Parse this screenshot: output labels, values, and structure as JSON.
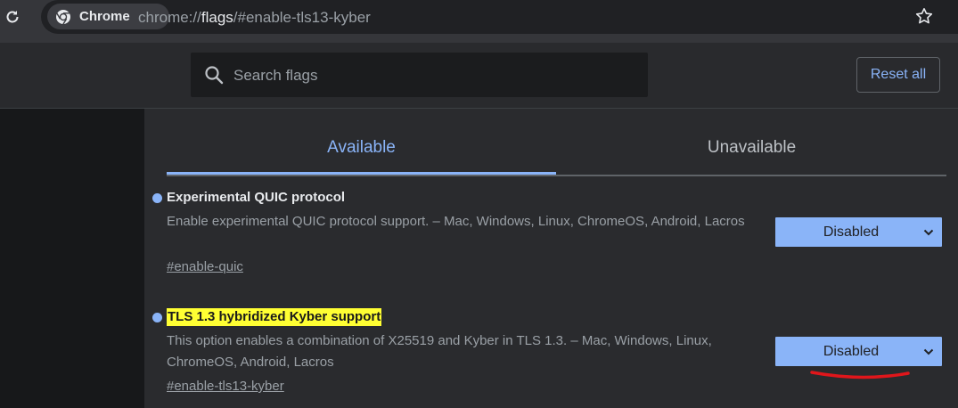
{
  "browser": {
    "chip_label": "Chrome",
    "url_scheme": "chrome://",
    "url_host": "flags",
    "url_path": "/#enable-tls13-kyber"
  },
  "header": {
    "search_placeholder": "Search flags",
    "reset_label": "Reset all"
  },
  "tabs": [
    {
      "label": "Available",
      "active": true
    },
    {
      "label": "Unavailable",
      "active": false
    }
  ],
  "flags": [
    {
      "title": "Experimental QUIC protocol",
      "description": "Enable experimental QUIC protocol support. – Mac, Windows, Linux, ChromeOS, Android, Lacros",
      "link": "#enable-quic",
      "value": "Disabled",
      "highlighted": false
    },
    {
      "title": "TLS 1.3 hybridized Kyber support",
      "description": "This option enables a combination of X25519 and Kyber in TLS 1.3. – Mac, Windows, Linux, ChromeOS, Android, Lacros",
      "link": "#enable-tls13-kyber",
      "value": "Disabled",
      "highlighted": true
    }
  ],
  "colors": {
    "accent": "#8ab4f8",
    "highlight": "#ffff33",
    "annotation": "#e0161b"
  },
  "icons": [
    "reload-icon",
    "chrome-logo-icon",
    "bookmark-star-icon",
    "search-icon",
    "chevron-down-icon"
  ]
}
